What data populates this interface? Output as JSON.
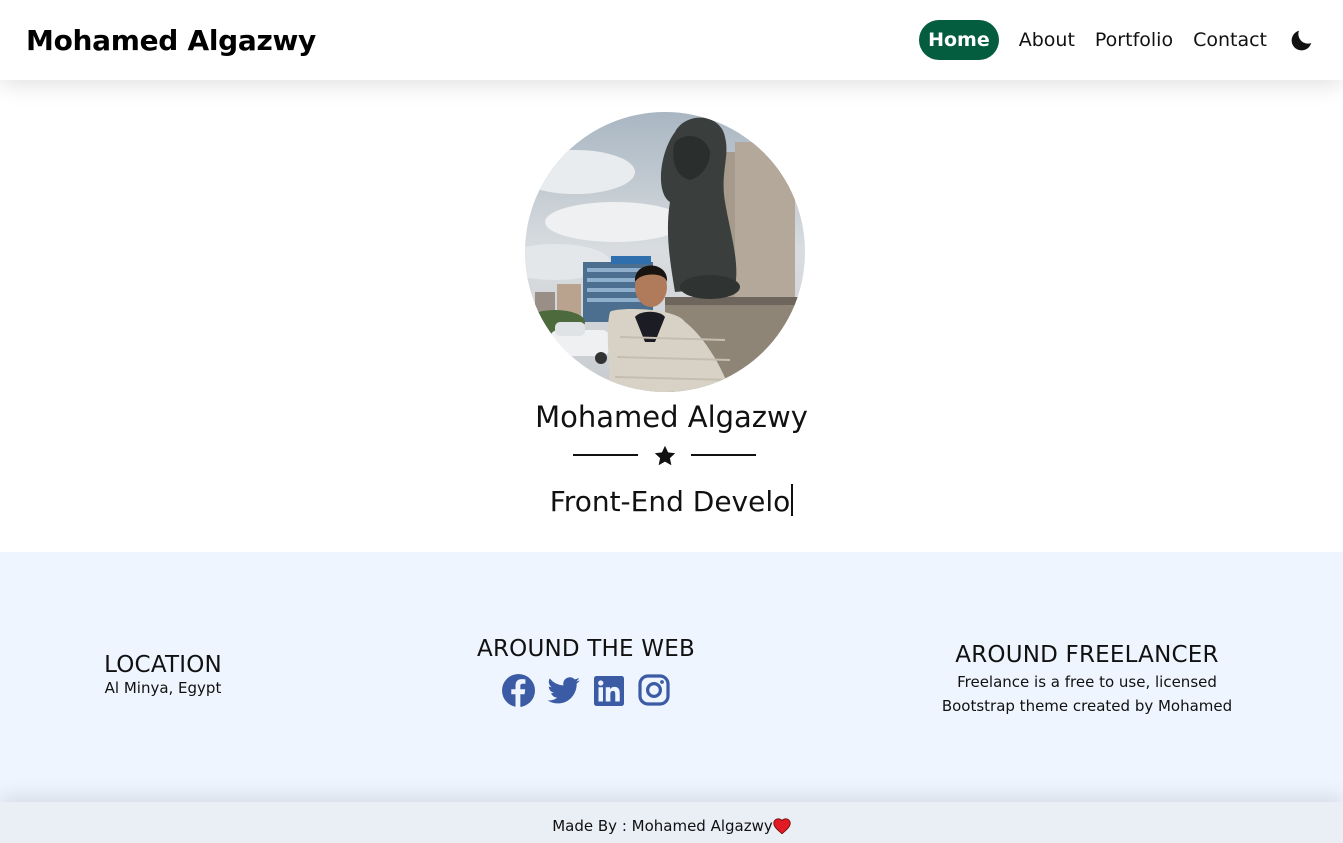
{
  "brand": "Mohamed Algazwy",
  "nav": {
    "items": [
      "Home",
      "About",
      "Portfolio",
      "Contact"
    ],
    "active": "Home",
    "theme_icon": "moon-icon"
  },
  "hero": {
    "name": "Mohamed Algazwy",
    "role_typing": "Front-End Develo",
    "divider_icon": "star-icon"
  },
  "info": {
    "location": {
      "title": "LOCATION",
      "text": "Al Minya, Egypt"
    },
    "web": {
      "title": "AROUND THE WEB",
      "icons": [
        "facebook-icon",
        "twitter-icon",
        "linkedin-icon",
        "instagram-icon"
      ]
    },
    "freelancer": {
      "title": "AROUND FREELANCER",
      "line1": "Freelance is a free to use, licensed",
      "line2": "Bootstrap theme created by Mohamed"
    }
  },
  "footer": {
    "text": "Made By : Mohamed Algazwy",
    "icon": "heart-icon"
  },
  "colors": {
    "accent": "#045d3f",
    "social": "#3b5ba5",
    "info_bg": "#eef5fe",
    "heart": "#e01b24"
  }
}
